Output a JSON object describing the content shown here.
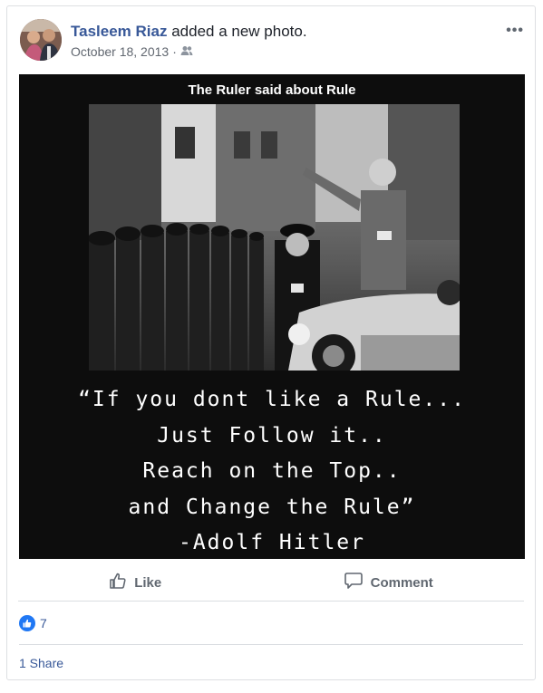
{
  "post": {
    "author_name": "Tasleem Riaz",
    "action_text": "added a new photo.",
    "date": "October 18, 2013",
    "date_separator": "·",
    "audience_icon": "friends-icon",
    "more_icon": "more-options-icon",
    "more_label": "•••"
  },
  "photo": {
    "top_caption": "The Ruler said about Rule",
    "quote_lines": [
      "“If you dont like a Rule...",
      "Just Follow it..",
      "Reach on the Top..",
      "and Change the Rule”",
      "-Adolf Hitler"
    ]
  },
  "actions": {
    "like_label": "Like",
    "comment_label": "Comment"
  },
  "footer": {
    "like_count": "7",
    "shares_label": "1 Share"
  },
  "colors": {
    "link": "#385898",
    "like_blue": "#2078f4",
    "muted": "#606770"
  }
}
